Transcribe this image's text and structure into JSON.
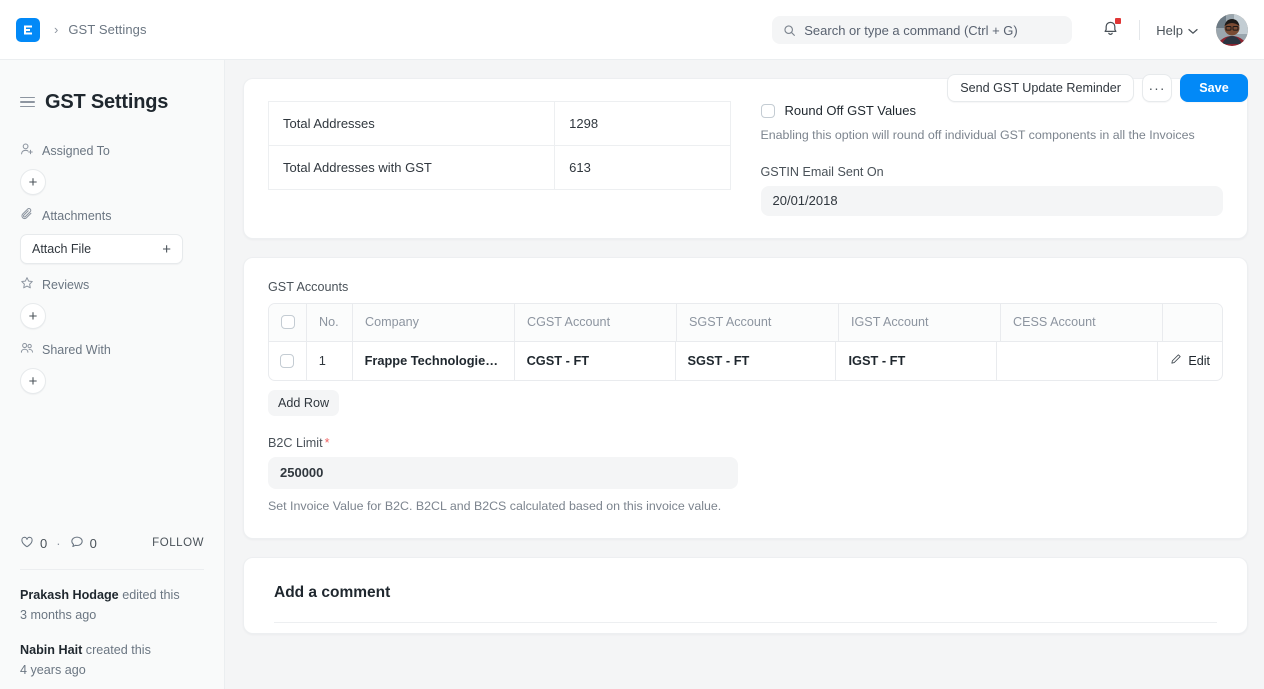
{
  "navbar": {
    "logo_icon": "erpnext-logo-icon",
    "breadcrumb_sep": "›",
    "breadcrumb": "GST Settings",
    "search": {
      "icon": "search-icon",
      "placeholder": "Search or type a command (Ctrl + G)",
      "value": ""
    },
    "notifications_icon": "bell-icon",
    "help_label": "Help",
    "help_caret_icon": "chevron-down-icon",
    "avatar": "user-avatar"
  },
  "page": {
    "menu_icon": "hamburger-menu-icon",
    "title": "GST Settings",
    "actions": {
      "reminder_label": "Send GST Update Reminder",
      "more_label": "···",
      "save_label": "Save"
    }
  },
  "sidebar": {
    "sections": [
      {
        "icon": "assign-user-icon",
        "label": "Assigned To",
        "add_label": "+"
      },
      {
        "icon": "paperclip-icon",
        "label": "Attachments",
        "attach_label": "Attach File",
        "attach_plus": "+"
      },
      {
        "icon": "star-icon",
        "label": "Reviews",
        "add_label": "+"
      },
      {
        "icon": "share-users-icon",
        "label": "Shared With",
        "add_label": "+"
      }
    ],
    "reactions": {
      "like_icon": "heart-icon",
      "like_count": "0",
      "separator": "·",
      "comment_icon": "comment-icon",
      "comment_count": "0",
      "follow_label": "FOLLOW"
    },
    "activity": [
      {
        "user": "Prakash Hodage",
        "action": "edited this",
        "time": "3 months ago"
      },
      {
        "user": "Nabin Hait",
        "action": "created this",
        "time": "4 years ago"
      }
    ]
  },
  "settings_card": {
    "stats_table": {
      "rows": [
        {
          "label": "Total Addresses",
          "value": "1298"
        },
        {
          "label": "Total Addresses with GST",
          "value": "613"
        }
      ]
    },
    "round_off": {
      "checked": false,
      "label": "Round Off GST Values",
      "description": "Enabling this option will round off individual GST components in all the Invoices"
    },
    "gstin_email": {
      "label": "GSTIN Email Sent On",
      "value": "20/01/2018"
    }
  },
  "accounts_card": {
    "grid_label": "GST Accounts",
    "columns": [
      "No.",
      "Company",
      "CGST Account",
      "SGST Account",
      "IGST Account",
      "CESS Account"
    ],
    "rows": [
      {
        "no": "1",
        "company": "Frappe Technologies ...",
        "cgst": "CGST - FT",
        "sgst": "SGST - FT",
        "igst": "IGST - FT",
        "cess": "",
        "edit_label": "Edit",
        "edit_icon": "pencil-icon"
      }
    ],
    "add_row_label": "Add Row",
    "b2c_limit": {
      "label": "B2C Limit",
      "required": "*",
      "value": "250000",
      "description": "Set Invoice Value for B2C. B2CL and B2CS calculated based on this invoice value."
    }
  },
  "comment_card": {
    "title": "Add a comment"
  },
  "colors": {
    "accent": "#0289f7",
    "badge": "#e03636",
    "page_bg": "#f4f5f6",
    "card_bg": "#ffffff"
  }
}
